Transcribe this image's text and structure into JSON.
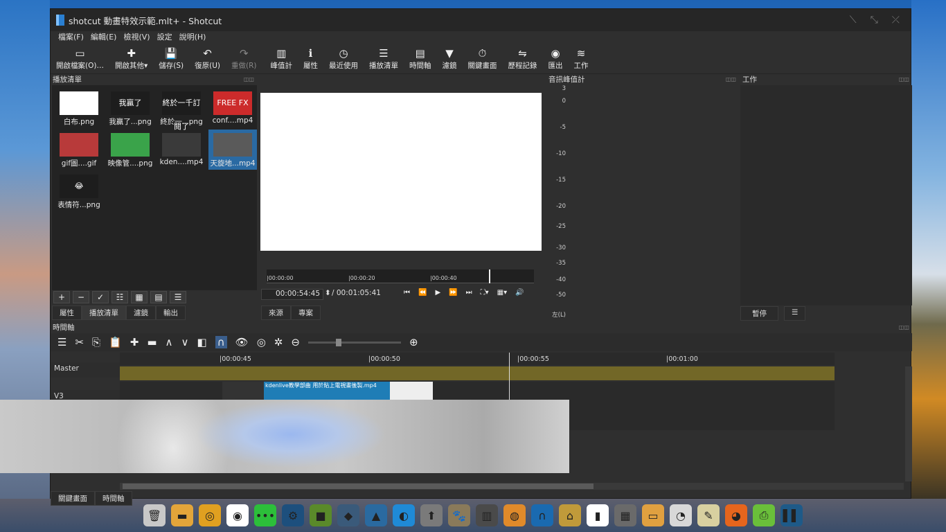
{
  "window": {
    "title": "shotcut 動畫特效示範.mlt+ - Shotcut"
  },
  "menu": [
    "檔案(F)",
    "編輯(E)",
    "檢視(V)",
    "設定",
    "說明(H)"
  ],
  "toolbar": [
    {
      "icon": "open-file-icon",
      "glyph": "▭",
      "label": "開啟檔案(O)…"
    },
    {
      "icon": "open-other-icon",
      "glyph": "✚",
      "label": "開啟其他▾"
    },
    {
      "icon": "save-icon",
      "glyph": "💾",
      "label": "儲存(S)"
    },
    {
      "icon": "undo-icon",
      "glyph": "↶",
      "label": "復原(U)"
    },
    {
      "icon": "redo-icon",
      "glyph": "↷",
      "label": "重做(R)",
      "dim": true
    },
    {
      "icon": "peak-meter-icon",
      "glyph": "▥",
      "label": "峰值計"
    },
    {
      "icon": "properties-icon",
      "glyph": "ℹ",
      "label": "屬性"
    },
    {
      "icon": "recent-icon",
      "glyph": "◷",
      "label": "最近使用"
    },
    {
      "icon": "playlist-icon",
      "glyph": "☰",
      "label": "播放清單"
    },
    {
      "icon": "timeline-icon",
      "glyph": "▤",
      "label": "時間軸"
    },
    {
      "icon": "filter-icon",
      "glyph": "▼",
      "label": "濾鏡"
    },
    {
      "icon": "keyframes-icon",
      "glyph": "⏱",
      "label": "關鍵畫面"
    },
    {
      "icon": "history-icon",
      "glyph": "⇋",
      "label": "歷程記錄"
    },
    {
      "icon": "export-icon",
      "glyph": "◉",
      "label": "匯出"
    },
    {
      "icon": "jobs-icon",
      "glyph": "≋",
      "label": "工作"
    }
  ],
  "playlist": {
    "title": "播放清單",
    "items": [
      {
        "label": "白布.png",
        "thumb_text": "",
        "bg": "#ffffff"
      },
      {
        "label": "我贏了...png",
        "thumb_text": "我贏了",
        "bg": "#1d1d1d"
      },
      {
        "label": "終於一...png",
        "thumb_text": "終於一千訂閱了",
        "bg": "#1d1d1d"
      },
      {
        "label": "conf....mp4",
        "thumb_text": "FREE FX",
        "bg": "#cc2b2b"
      },
      {
        "label": "gif圖....gif",
        "thumb_text": "",
        "bg": "#b83a3a"
      },
      {
        "label": "映像管....png",
        "thumb_text": "",
        "bg": "#3aa34a"
      },
      {
        "label": "kden....mp4",
        "thumb_text": "",
        "bg": "#3a3a3a"
      },
      {
        "label": "天旋地...mp4",
        "thumb_text": "",
        "bg": "#5a5a5a",
        "selected": true
      },
      {
        "label": "表情符...png",
        "thumb_text": "😂",
        "bg": "#1d1d1d"
      }
    ],
    "buttons": [
      "+",
      "−",
      "✓",
      "☷",
      "▦",
      "▤",
      "☰"
    ],
    "tabs": [
      "屬性",
      "播放清單",
      "濾鏡",
      "輸出"
    ]
  },
  "viewer": {
    "ticks": [
      "|00:00:00",
      "|00:00:20",
      "|00:00:40"
    ],
    "timecode": "00:00:54:45",
    "duration": "/ 00:01:05:41",
    "tabs": [
      "來源",
      "專案"
    ]
  },
  "meter": {
    "title": "音訊峰值計",
    "scale": [
      "3",
      "0",
      "-5",
      "-10",
      "-15",
      "-20",
      "-25",
      "-30",
      "-35",
      "-40",
      "-50"
    ],
    "footer": "左(L)"
  },
  "jobs": {
    "title": "工作",
    "pause": "暫停",
    "menu": "☰"
  },
  "timeline": {
    "title": "時間軸",
    "ruler": [
      "|00:00:45",
      "|00:00:50",
      "|00:00:55",
      "|00:01:00"
    ],
    "master": "Master",
    "track": "V3",
    "clip_label": "kdenlive教學部曲 用於貼上電視畫後製.mp4",
    "bottom_tabs": [
      "關鍵畫面",
      "時間軸"
    ]
  },
  "taskbar": [
    {
      "icon": "trash-icon",
      "color": "#c8c8c8",
      "glyph": "🗑"
    },
    {
      "icon": "files-icon",
      "color": "#e3a53a",
      "glyph": "▬"
    },
    {
      "icon": "chrome-icon",
      "color": "#e0a020",
      "glyph": "◎"
    },
    {
      "icon": "music-icon",
      "color": "#ffffff",
      "glyph": "◉"
    },
    {
      "icon": "chat-icon",
      "color": "#2cbf3a",
      "glyph": "•••"
    },
    {
      "icon": "steam-icon",
      "color": "#1d4f7d",
      "glyph": "⚙"
    },
    {
      "icon": "minecraft-icon",
      "color": "#5a8a2a",
      "glyph": "■"
    },
    {
      "icon": "cube-icon",
      "color": "#3a5a7a",
      "glyph": "◆"
    },
    {
      "icon": "inkscape-icon",
      "color": "#2a6aa0",
      "glyph": "▲"
    },
    {
      "icon": "firefox-dev-icon",
      "color": "#1f8ad6",
      "glyph": "◐"
    },
    {
      "icon": "upload-icon",
      "color": "#7a7a7a",
      "glyph": "⬆"
    },
    {
      "icon": "gimp-icon",
      "color": "#8a7a5a",
      "glyph": "🐾"
    },
    {
      "icon": "film-icon",
      "color": "#4a4a4a",
      "glyph": "▥"
    },
    {
      "icon": "blender-icon",
      "color": "#e08a2a",
      "glyph": "◍"
    },
    {
      "icon": "audio-icon",
      "color": "#1a6ab0",
      "glyph": "∩"
    },
    {
      "icon": "ardour-icon",
      "color": "#c09a3a",
      "glyph": "⌂"
    },
    {
      "icon": "piano-icon",
      "color": "#ffffff",
      "glyph": "▮"
    },
    {
      "icon": "calculator-icon",
      "color": "#6a6a6a",
      "glyph": "▦"
    },
    {
      "icon": "notes-icon",
      "color": "#e0a040",
      "glyph": "▭"
    },
    {
      "icon": "disk-icon",
      "color": "#d8d8d8",
      "glyph": "◔"
    },
    {
      "icon": "tools-icon",
      "color": "#d8d0a0",
      "glyph": "✎"
    },
    {
      "icon": "firefox-icon",
      "color": "#e6651d",
      "glyph": "◕"
    },
    {
      "icon": "printer-icon",
      "color": "#6abf3a",
      "glyph": "⎙"
    },
    {
      "icon": "shotcut-icon",
      "color": "#1e5a88",
      "glyph": "▌▌"
    }
  ]
}
